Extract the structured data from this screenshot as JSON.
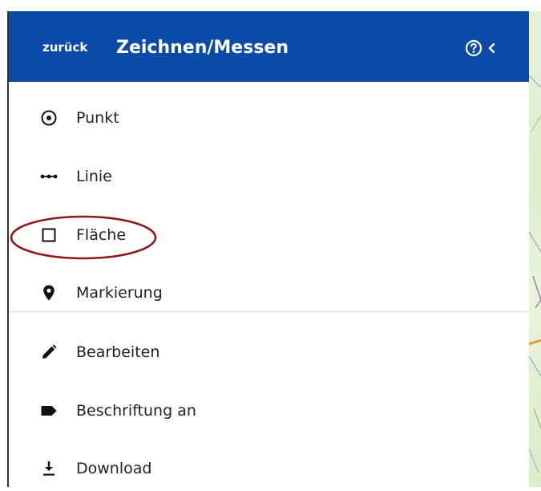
{
  "header": {
    "back_label": "zurück",
    "title": "Zeichnen/Messen",
    "help_icon": "help-circle-icon",
    "collapse_icon": "chevron-left-icon",
    "background_color": "#0b4aa6"
  },
  "menu": {
    "draw_items": [
      {
        "label": "Punkt",
        "icon": "radio-point-icon"
      },
      {
        "label": "Linie",
        "icon": "line-dots-icon"
      },
      {
        "label": "Fläche",
        "icon": "square-outline-icon"
      },
      {
        "label": "Markierung",
        "icon": "map-marker-icon"
      }
    ],
    "tool_items": [
      {
        "label": "Bearbeiten",
        "icon": "pencil-icon"
      },
      {
        "label": "Beschriftung an",
        "icon": "label-tag-icon"
      },
      {
        "label": "Download",
        "icon": "download-icon"
      }
    ]
  },
  "annotation": {
    "highlighted_item": "Fläche",
    "color": "#8b1a1a"
  }
}
